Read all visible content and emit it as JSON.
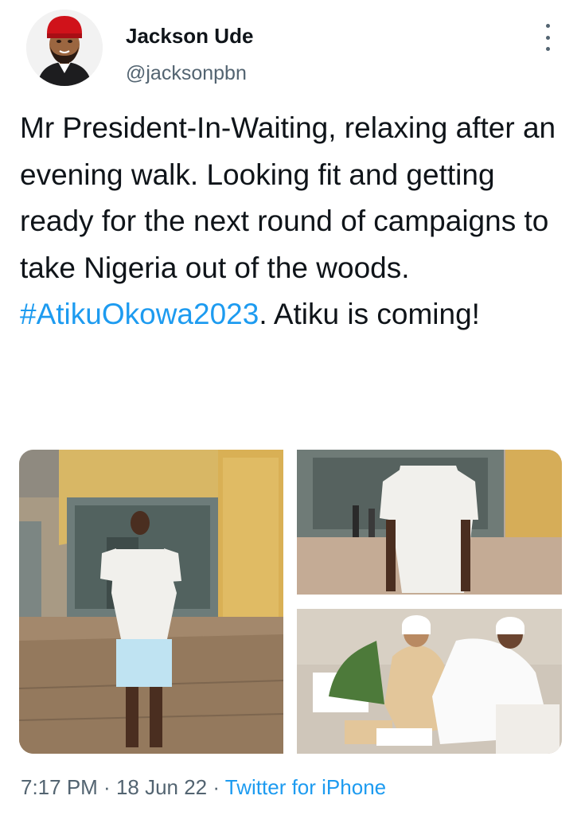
{
  "author": {
    "name": "Jackson Ude",
    "handle": "@jacksonpbn"
  },
  "tweet": {
    "text_before": "Mr President-In-Waiting, relaxing after an evening walk. Looking fit and getting ready for the next round of campaigns to take Nigeria out of the woods.",
    "hashtag": "#AtikuOkowa2023",
    "text_after": ". Atiku is coming!"
  },
  "meta": {
    "time": "7:17 PM",
    "separator": " · ",
    "date": "18 Jun 22",
    "source": "Twitter for iPhone"
  },
  "colors": {
    "link": "#1d9bf0",
    "secondary_text": "#536471",
    "primary_text": "#0f1419"
  },
  "icons": {
    "more": "vertical-ellipsis-icon"
  }
}
